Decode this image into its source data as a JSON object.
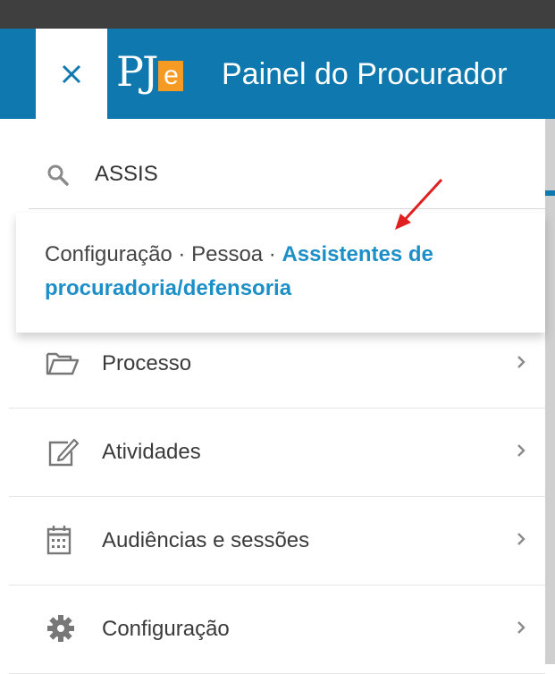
{
  "header": {
    "close_icon": "close-icon",
    "logo_pj": "PJ",
    "logo_e": "e",
    "title": "Painel do Procurador",
    "bg_color": "#0f78ae"
  },
  "search": {
    "icon": "search-icon",
    "value": "ASSIS"
  },
  "suggestion": {
    "path": "Configuração · Pessoa · ",
    "link": "Assistentes de procuradoria/defensoria",
    "link_color": "#1d8fc7"
  },
  "menu": {
    "items": [
      {
        "label": "Processo",
        "icon": "folder-icon"
      },
      {
        "label": "Atividades",
        "icon": "edit-icon"
      },
      {
        "label": "Audiências e sessões",
        "icon": "calendar-icon"
      },
      {
        "label": "Configuração",
        "icon": "gear-icon"
      }
    ]
  }
}
